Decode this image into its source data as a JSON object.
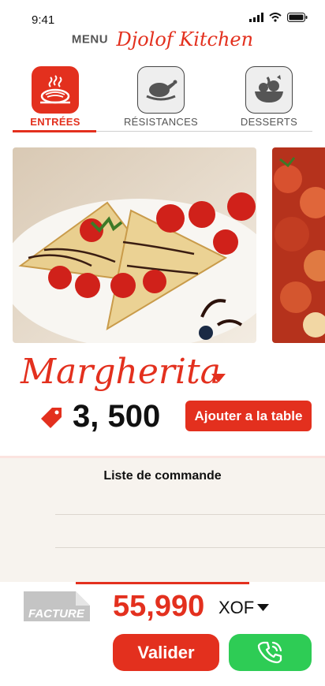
{
  "status_bar": {
    "time": "9:41"
  },
  "header": {
    "menu_label": "MENU",
    "brand": "Djolof Kitchen"
  },
  "tabs": [
    {
      "label": "ENTRÉES",
      "icon": "pasta-plate-icon",
      "active": true
    },
    {
      "label": "RÉSISTANCES",
      "icon": "roast-chicken-icon",
      "active": false
    },
    {
      "label": "DESSERTS",
      "icon": "fruit-bowl-icon",
      "active": false
    }
  ],
  "dish": {
    "name": "Margherita",
    "price": "3, 500",
    "add_label": "Ajouter a la table"
  },
  "order": {
    "title": "Liste de commande"
  },
  "footer": {
    "facture_label": "FACTURE",
    "total": "55,990",
    "currency": "XOF",
    "validate_label": "Valider"
  },
  "colors": {
    "accent": "#e3301e",
    "call": "#2ecc55",
    "panel": "#f7f3ee"
  }
}
